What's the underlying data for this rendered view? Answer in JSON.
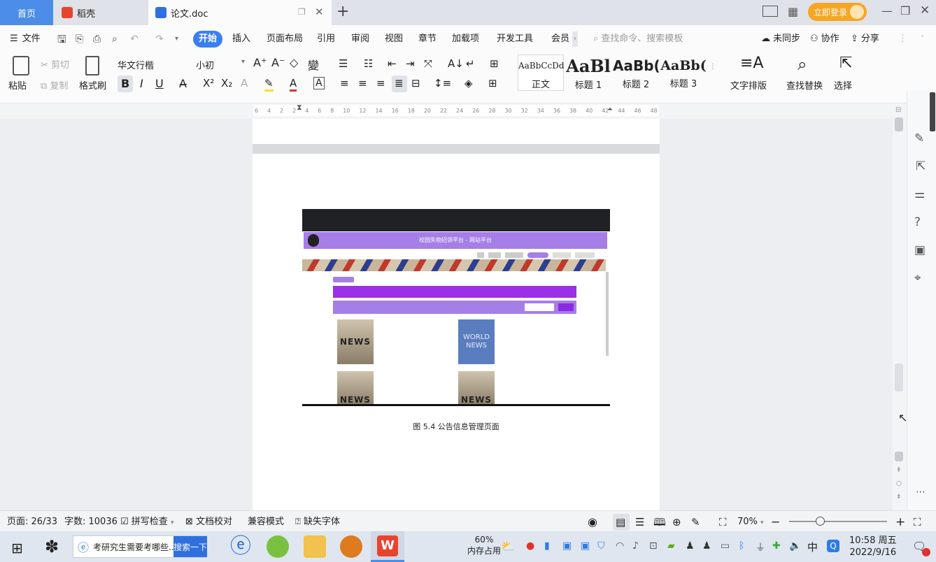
{
  "tabs": {
    "home": "首页",
    "daoke": "稻壳",
    "doc": "论文.doc",
    "add": "+"
  },
  "header": {
    "login": "立即登录"
  },
  "menu": {
    "file": "文件",
    "items": [
      "开始",
      "插入",
      "页面布局",
      "引用",
      "审阅",
      "视图",
      "章节",
      "加载项",
      "开发工具",
      "会员"
    ],
    "search_placeholder": "查找命令、搜索模板",
    "sync": "未同步",
    "collab": "协作",
    "share": "分享"
  },
  "ribbon": {
    "paste": "粘贴",
    "cut": "剪切",
    "copy": "复制",
    "format_painter": "格式刷",
    "font_name": "华文行楷",
    "font_size": "小初",
    "styles": [
      {
        "preview": "AaBbCcDd",
        "label": "正文"
      },
      {
        "preview": "AaBl",
        "label": "标题 1"
      },
      {
        "preview": "AaBb(",
        "label": "标题 2"
      },
      {
        "preview": "AaBb(",
        "label": "标题 3"
      }
    ],
    "text_layout": "文字排版",
    "find_replace": "查找替换",
    "select": "选择"
  },
  "ruler": {
    "ticks": [
      "6",
      "4",
      "2",
      "2",
      "4",
      "6",
      "8",
      "10",
      "12",
      "14",
      "16",
      "18",
      "20",
      "22",
      "24",
      "26",
      "28",
      "30",
      "32",
      "34",
      "36",
      "38",
      "40",
      "42",
      "44",
      "46",
      "48"
    ]
  },
  "document": {
    "caption": "图 5.4  公告信息管理页面",
    "figure": {
      "site_title": "校园失物招领平台 - 网站平台",
      "news_label": "NEWS",
      "world_news_label": "WORLD NEWS"
    }
  },
  "status": {
    "page": "页面: 26/33",
    "words": "字数: 10036",
    "spell": "拼写检查",
    "proof": "文档校对",
    "compat": "兼容模式",
    "missing_font": "缺失字体",
    "zoom": "70%"
  },
  "taskbar": {
    "search_text": "考研究生需要考哪些...",
    "search_button": "搜索一下",
    "memory_pct": "60%",
    "memory_label": "内存占用",
    "ime": "中",
    "time": "10:58 周五",
    "date": "2022/9/16"
  },
  "colors": {
    "accent": "#4b8de8",
    "start_tab": "#3a7ff0",
    "login": "#f5a623",
    "purple": "#a67ee8",
    "wps_red": "#e8432e"
  }
}
